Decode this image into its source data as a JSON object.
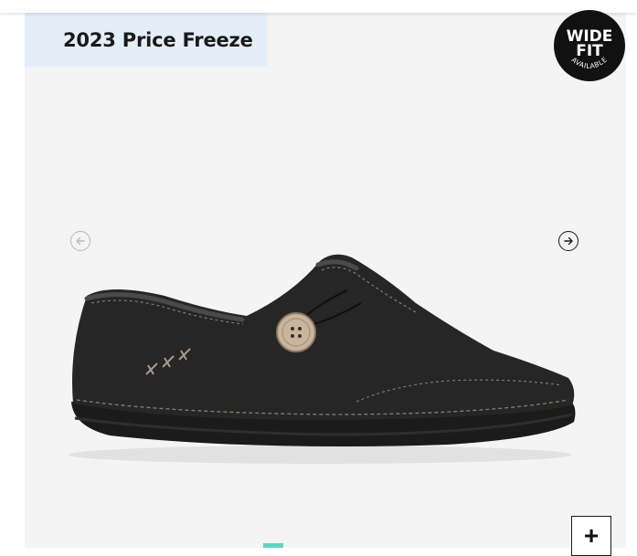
{
  "promo": {
    "label": "2023 Price Freeze"
  },
  "badge": {
    "line1": "WIDE",
    "line2": "FIT",
    "line3": "AVAILABLE"
  },
  "gallery": {
    "prev_icon": "arrow-left-circle-icon",
    "next_icon": "arrow-right-circle-icon",
    "zoom_label": "+",
    "image_alt": "black leather slip-on shoe",
    "active_slide": 1
  },
  "colors": {
    "promo_bg": "#e4eef8",
    "badge_bg": "#111111",
    "gallery_bg": "#f4f4f4",
    "indicator": "#5fd3c0"
  }
}
